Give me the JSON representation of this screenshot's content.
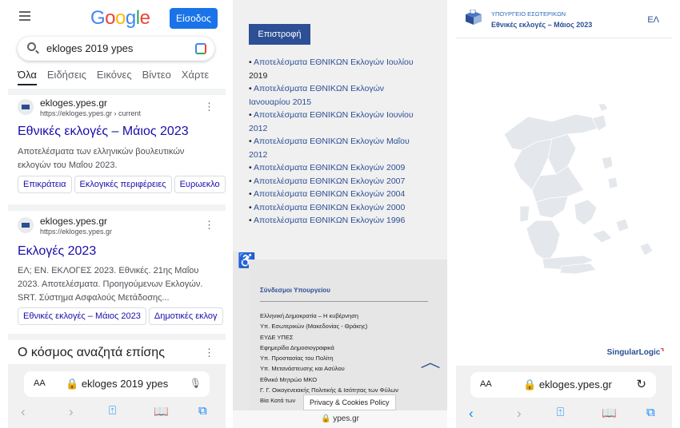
{
  "google": {
    "logo": "Google",
    "signin_label": "Είσοδος",
    "search_query": "ekloges 2019 ypes",
    "tabs": [
      "Όλα",
      "Ειδήσεις",
      "Εικόνες",
      "Βίντεο",
      "Χάρτε"
    ],
    "results": [
      {
        "site": "ekloges.ypes.gr",
        "url": "https://ekloges.ypes.gr › current",
        "title": "Εθνικές εκλογές – Μάιος 2023",
        "snippet": "Αποτελέσματα των ελληνικών βουλευτικών εκλογών του Μαΐου 2023.",
        "chips": [
          "Επικράτεια",
          "Εκλογικές περιφέρειες",
          "Ευρωεκλο"
        ]
      },
      {
        "site": "ekloges.ypes.gr",
        "url": "https://ekloges.ypes.gr",
        "title": "Εκλογές 2023",
        "snippet": "ΕΛ; ΕΝ. ΕΚΛΟΓΕΣ 2023. Εθνικές. 21ης Μαΐου 2023. Αποτελέσματα. Προηγούμενων Εκλογών. SRT. Σύστημα Ασφαλούς Μετάδοσης...",
        "chips": [
          "Εθνικές εκλογές – Μάιος 2023",
          "Δημοτικές εκλογ"
        ]
      }
    ],
    "also_searched": "Ο κόσμος αναζητά επίσης",
    "bottom_bar": {
      "aa": "AA",
      "url_text": "ekloges 2019 ypes"
    }
  },
  "ypes": {
    "back_label": "Επιστροφή",
    "elections": [
      [
        "Αποτελέσματα ΕΘΝΙΚΩΝ Εκλογών Ιουλίου",
        "2019"
      ],
      [
        "Αποτελέσματα ΕΘΝΙΚΩΝ Εκλογών",
        "Ιανουαρίου 2015"
      ],
      [
        "Αποτελέσματα ΕΘΝΙΚΩΝ Εκλογών Ιουνίου",
        "2012"
      ],
      [
        "Αποτελέσματα ΕΘΝΙΚΩΝ Εκλογών Μαΐου",
        "2012"
      ],
      [
        "Αποτελέσματα ΕΘΝΙΚΩΝ Εκλογών 2009",
        ""
      ],
      [
        "Αποτελέσματα ΕΘΝΙΚΩΝ Εκλογών 2007",
        ""
      ],
      [
        "Αποτελέσματα ΕΘΝΙΚΩΝ Εκλογών 2004",
        ""
      ],
      [
        "Αποτελέσματα ΕΘΝΙΚΩΝ Εκλογών 2000",
        ""
      ],
      [
        "Αποτελέσματα ΕΘΝΙΚΩΝ Εκλογών 1996",
        ""
      ]
    ],
    "links_title": "Σύνδεσμοι Υπουργείου",
    "links": [
      "Ελληνική Δημοκρατία – Η κυβέρνηση",
      "Υπ. Εσωτερικών (Μακεδονίας - Θράκης)",
      "ΕΥΔΕ ΥΠΕΣ",
      "Εφημερίδα Δημοσιογραφικά",
      "Υπ. Προστασίας του Πολίτη",
      "Υπ. Μετανάστευσης και Ασύλου",
      "Εθνικό Μητρώο ΜΚΟ",
      "Γ. Γ. Οικογενειακής Πολιτικής & Ισότητας των Φύλων",
      "Βία Κατά των"
    ],
    "privacy_label": "Privacy & Cookies Policy",
    "bottom_url": "ypes.gr"
  },
  "map_page": {
    "ministry": "ΥΠΟΥΡΓΕΙΟ ΕΣΩΤΕΡΙΚΩΝ",
    "election_title": "Εθνικές εκλογές – Μάιος 2023",
    "lang": "ΕΛ",
    "vendor_main": "SingularLogic",
    "bottom_bar": {
      "aa": "AA",
      "url_text": "ekloges.ypes.gr"
    }
  },
  "colors": {
    "google_blue": "#1a73e8",
    "link": "#1a0dab",
    "ypes_blue": "#2c4f95",
    "ios_blue": "#0a84ff",
    "map_fill": "#e4e7ec"
  }
}
